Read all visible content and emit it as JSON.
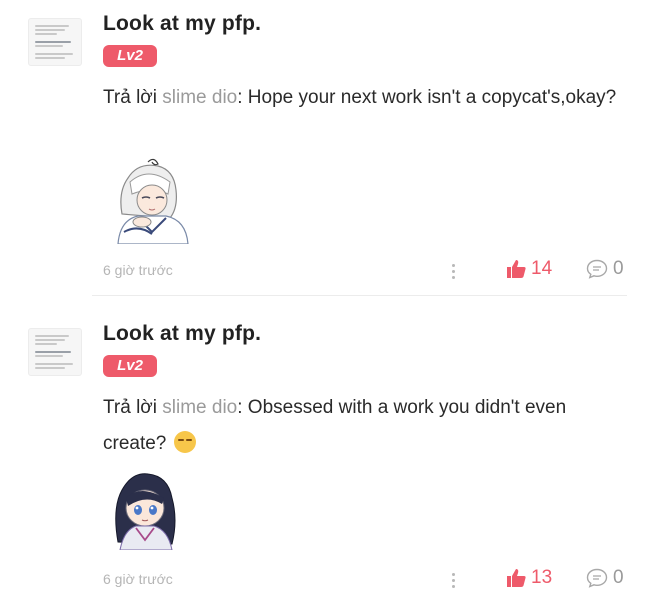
{
  "comments": [
    {
      "author": "Look at my pfp.",
      "level": "Lv2",
      "reply_prefix": "Trả lời ",
      "mention": "slime dio",
      "text": ": Hope your next work isn't a copycat's,okay?",
      "sticker": "white-haired-anime-character-sticker",
      "time": "6 giờ trước",
      "likes": "14",
      "replies": "0"
    },
    {
      "author": "Look at my pfp.",
      "level": "Lv2",
      "reply_prefix": "Trả lời ",
      "mention": "slime dio",
      "text": ": Obsessed with a work you didn't even create? ",
      "emoji": "relieved-face-emoji",
      "sticker": "dark-haired-anime-character-sticker",
      "time": "6 giờ trước",
      "likes": "13",
      "replies": "0"
    }
  ],
  "colors": {
    "accent": "#ee5a6a",
    "muted": "#b5b5b5",
    "mention": "#9a9a9a"
  },
  "icons": {
    "like": "thumbs-up-icon",
    "reply": "comment-bubble-icon",
    "more": "more-vertical-icon"
  }
}
